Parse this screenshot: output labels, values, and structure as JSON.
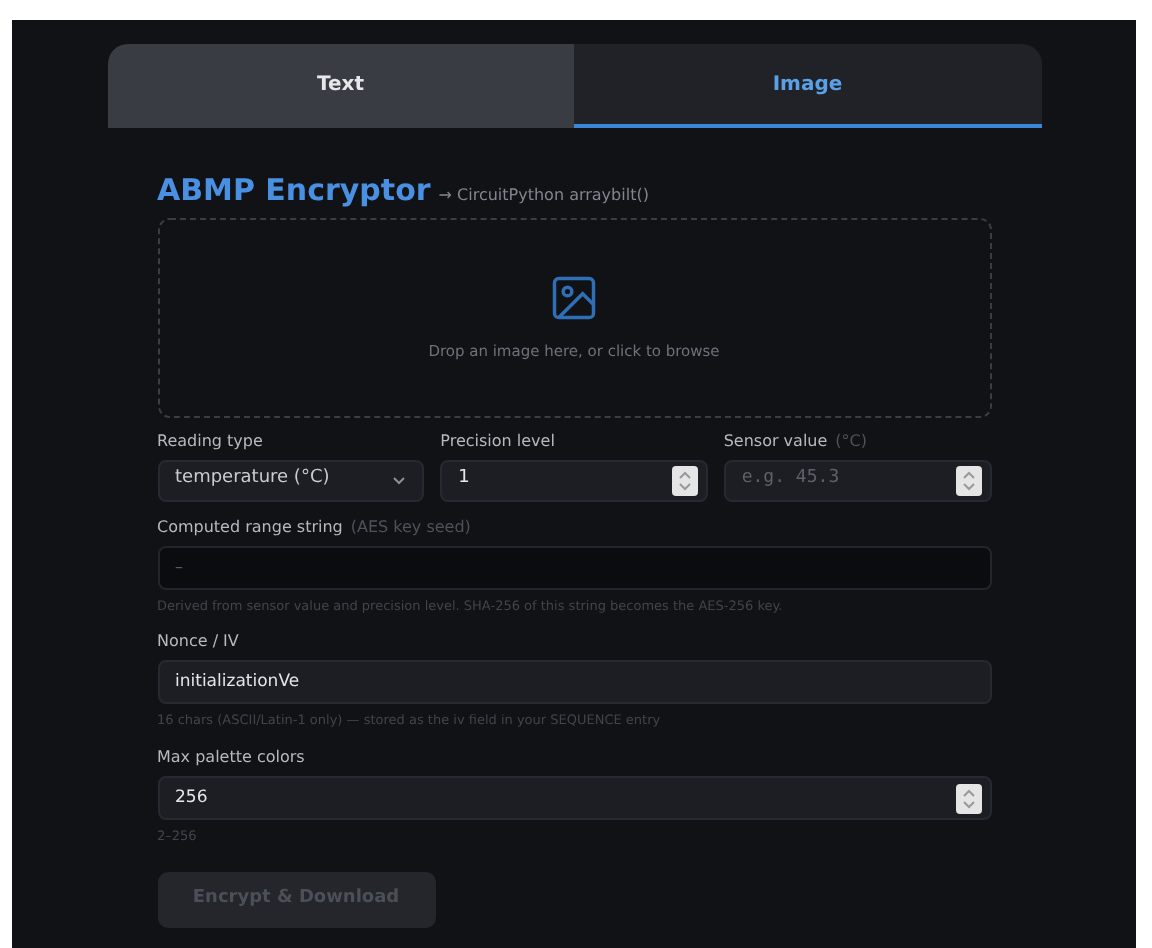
{
  "tabs": [
    {
      "label": "Text",
      "selected": false
    },
    {
      "label": "Image",
      "selected": true
    }
  ],
  "title": "ABMP Encryptor",
  "subtitle": "→ CircuitPython arraybilt()",
  "dropzone": {
    "text": "Drop an image here, or click to browse"
  },
  "row_fields": [
    {
      "kind": "select",
      "label": "Reading type",
      "value": "temperature (°C)"
    },
    {
      "kind": "number",
      "label": "Precision level",
      "value": "1"
    },
    {
      "kind": "number",
      "label": "Sensor value",
      "hint": "(°C)",
      "placeholder": "e.g. 45.3"
    }
  ],
  "computed": {
    "label": "Computed range string",
    "hint": "(AES key seed)",
    "placeholder": "–",
    "help": "Derived from sensor value and precision level. SHA-256 of this string becomes the AES-256 key."
  },
  "nonce": {
    "label": "Nonce / IV",
    "value": "initializationVe",
    "help": "16 chars (ASCII/Latin-1 only) — stored as the iv field in your SEQUENCE entry"
  },
  "palette": {
    "label": "Max palette colors",
    "value": "256",
    "help": "2–256"
  },
  "button": {
    "label": "Encrypt & Download",
    "disabled": true
  }
}
